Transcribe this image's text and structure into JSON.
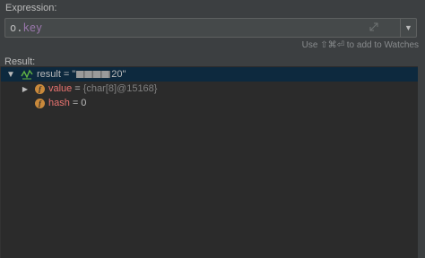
{
  "expression": {
    "label": "Expression:",
    "object": "o",
    "dot": ".",
    "field": "key",
    "history_icon": "dropdown-arrow-icon",
    "expand_icon": "expand-editor-icon"
  },
  "hint": "Use ⇧⌘⏎ to add to Watches",
  "result": {
    "label": "Result:",
    "rows": [
      {
        "name": "result",
        "eq": "=",
        "value_prefix": "\"",
        "value_suffix": " 20\"",
        "icon": "watch-result-icon",
        "expanded": true
      },
      {
        "name": "value",
        "eq": "=",
        "value": "{char[8]@15168}",
        "icon": "field-icon",
        "icon_letter": "f",
        "collapsed": true
      },
      {
        "name": "hash",
        "eq": "=",
        "value": "0",
        "icon": "field-icon",
        "icon_letter": "f"
      }
    ]
  },
  "colors": {
    "background": "#3c3f41",
    "tree_background": "#2b2b2b",
    "selected_row": "#0d293e",
    "field_name": "#e8736f",
    "field_icon": "#c9893b",
    "expr_field": "#9876aa"
  }
}
